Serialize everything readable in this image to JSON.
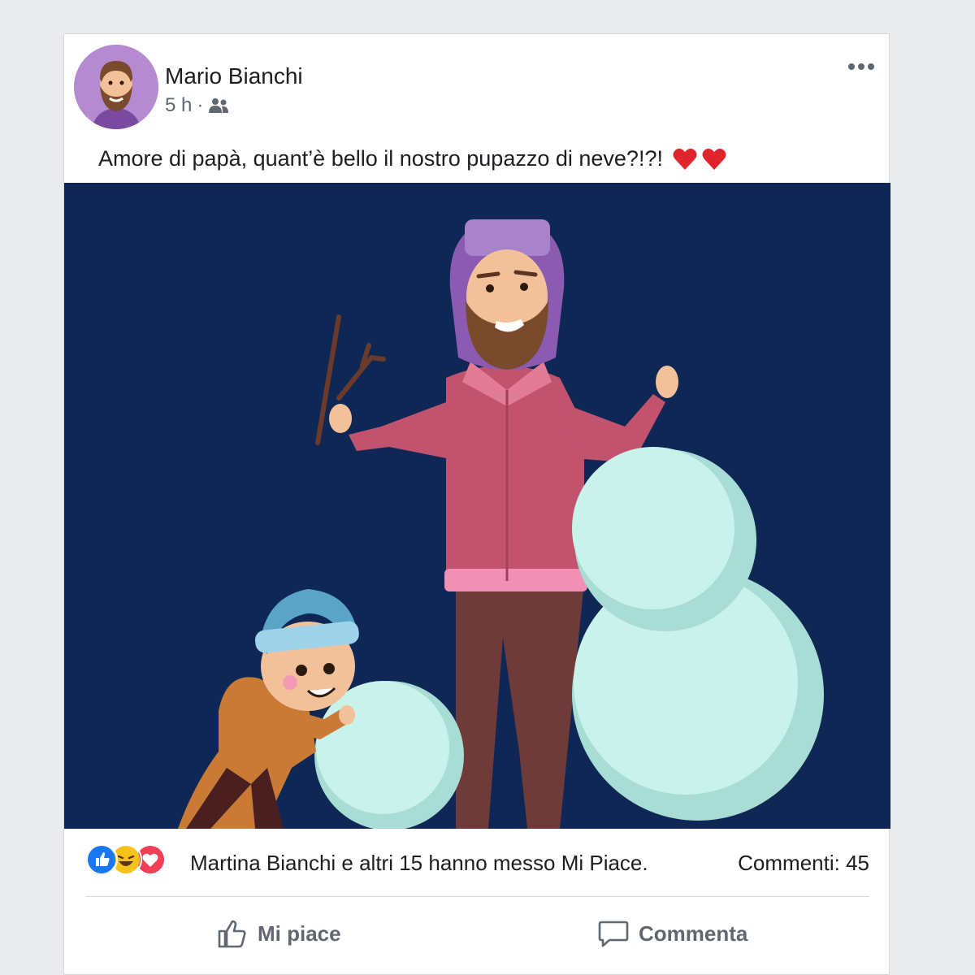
{
  "post": {
    "author": "Mario Bianchi",
    "time": "5 h",
    "separator": "·",
    "audience_icon": "friends-icon",
    "text": "Amore di papà, quant’è bello il nostro pupazzo di neve?!?!",
    "emoji": [
      "heart-icon",
      "heart-icon"
    ]
  },
  "reactions": {
    "icons": [
      "like-reaction-icon",
      "haha-reaction-icon",
      "love-reaction-icon"
    ],
    "summary": "Martina Bianchi e altri 15 hanno messo Mi Piace.",
    "comments": "Commenti: 45"
  },
  "actions": {
    "like_label": "Mi piace",
    "comment_label": "Commenta"
  },
  "colors": {
    "page_bg": "#eaebed",
    "card_bg": "#ffffff",
    "illustration_bg": "#0f2755",
    "heart": "#e0242b",
    "like_blue": "#1877f2",
    "secondary_text": "#606770"
  }
}
